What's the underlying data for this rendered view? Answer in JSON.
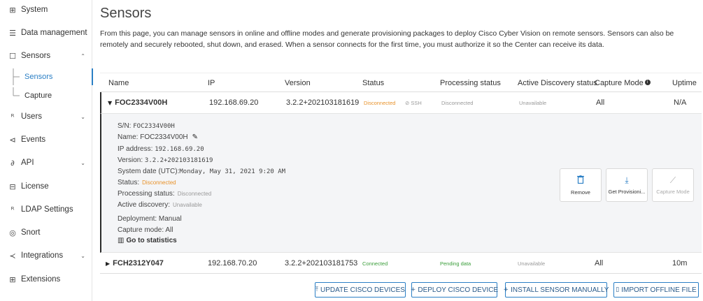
{
  "sidebar": {
    "items": [
      {
        "icon": "⊞",
        "icon_name": "system-icon",
        "label": "System"
      },
      {
        "icon": "☰",
        "icon_name": "data-management-icon",
        "label": "Data management"
      },
      {
        "icon": "☐",
        "icon_name": "sensors-icon",
        "label": "Sensors",
        "chevron": "⌃"
      },
      {
        "icon": "ᴿ",
        "icon_name": "users-icon",
        "label": "Users",
        "chevron": "⌄"
      },
      {
        "icon": "⊲",
        "icon_name": "events-icon",
        "label": "Events"
      },
      {
        "icon": "∂",
        "icon_name": "api-icon",
        "label": "API",
        "chevron": "⌄"
      },
      {
        "icon": "⊟",
        "icon_name": "license-icon",
        "label": "License"
      },
      {
        "icon": "ᴿ",
        "icon_name": "ldap-icon",
        "label": "LDAP Settings"
      },
      {
        "icon": "◎",
        "icon_name": "snort-icon",
        "label": "Snort"
      },
      {
        "icon": "≺",
        "icon_name": "integrations-icon",
        "label": "Integrations",
        "chevron": "⌄"
      },
      {
        "icon": "⊞",
        "icon_name": "extensions-icon",
        "label": "Extensions"
      }
    ],
    "sub_items": [
      {
        "label": "Sensors"
      },
      {
        "label": "Capture"
      }
    ]
  },
  "main": {
    "title": "Sensors",
    "description": "From this page, you can manage sensors in online and offline modes and generate provisioning packages to deploy Cisco Cyber Vision on remote sensors. Sensors can also be remotely and securely rebooted, shut down, and erased. When a sensor connects for the first time, you must authorize it so the Center can receive its data."
  },
  "table": {
    "headers": {
      "name": "Name",
      "ip": "IP",
      "version": "Version",
      "status": "Status",
      "processing": "Processing status",
      "discovery": "Active Discovery status",
      "capture": "Capture Mode",
      "uptime": "Uptime"
    },
    "rows": [
      {
        "caret": "▼",
        "name": "FOC2334V00H",
        "ip": "192.168.69.20",
        "version": "3.2.2+202103181619",
        "status": "Disconnected",
        "ssh": "⊘ SSH",
        "processing": "Disconnected",
        "discovery": "Unavailable",
        "capture": "All",
        "uptime": "N/A"
      },
      {
        "caret": "▶",
        "name": "FCH2312Y047",
        "ip": "192.168.70.20",
        "version": "3.2.2+202103181753",
        "status": "Connected",
        "processing": "Pending data",
        "discovery": "Unavailable",
        "capture": "All",
        "uptime": "10m"
      }
    ]
  },
  "detail": {
    "sn_label": "S/N:",
    "sn": "FOC2334V00H",
    "name_label": "Name:",
    "name": "FOC2334V00H",
    "ip_label": "IP address:",
    "ip": "192.168.69.20",
    "version_label": "Version:",
    "version": "3.2.2+202103181619",
    "sysdate_label": "System date (UTC):",
    "sysdate": "Monday, May 31, 2021 9:20 AM",
    "status_label": "Status:",
    "status": "Disconnected",
    "processing_label": "Processing status:",
    "processing": "Disconnected",
    "discovery_label": "Active discovery:",
    "discovery": "Unavailable",
    "deployment": "Deployment: Manual",
    "capture_mode": "Capture mode: All",
    "stats_link": "Go to statistics",
    "stats_icon": "▥",
    "actions": {
      "remove": {
        "icon": "🗑",
        "label": "Remove"
      },
      "provision": {
        "icon": "⤓",
        "label": "Get Provisioni..."
      },
      "capture": {
        "icon": "⟋",
        "label": "Capture Mode"
      }
    }
  },
  "buttons": {
    "update": {
      "icon": "⤒",
      "label": "UPDATE CISCO DEVICES"
    },
    "deploy": {
      "icon": "+",
      "label": "DEPLOY CISCO DEVICE"
    },
    "install": {
      "icon": "+",
      "label": "INSTALL SENSOR MANUALLY"
    },
    "import": {
      "icon": "▯",
      "label": "IMPORT OFFLINE FILE"
    }
  },
  "colors": {
    "accent": "#2b7fc5",
    "disconnected": "#e8922a",
    "connected": "#3b9e3b"
  }
}
